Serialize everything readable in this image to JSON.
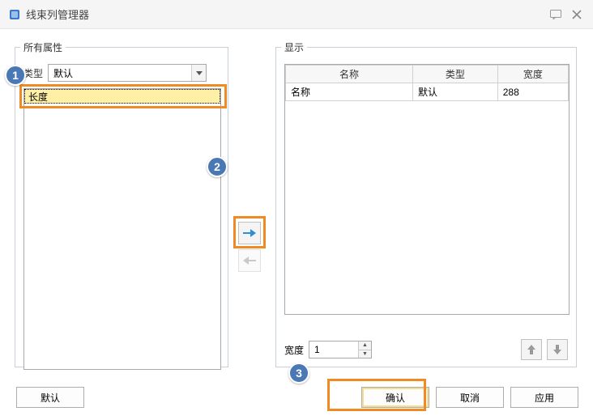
{
  "window": {
    "title": "线束列管理器"
  },
  "left_panel": {
    "legend": "所有属性",
    "type_label": "类型",
    "type_value": "默认",
    "items": [
      {
        "label": "长度",
        "selected": true
      }
    ]
  },
  "right_panel": {
    "legend": "显示",
    "columns": {
      "name": "名称",
      "type": "类型",
      "width": "宽度"
    },
    "rows": [
      {
        "name": "名称",
        "type": "默认",
        "width": "288"
      }
    ],
    "width_label": "宽度",
    "width_value": "1"
  },
  "buttons": {
    "default": "默认",
    "ok": "确认",
    "cancel": "取消",
    "apply": "应用"
  },
  "callouts": {
    "c1": "1",
    "c2": "2",
    "c3": "3"
  }
}
